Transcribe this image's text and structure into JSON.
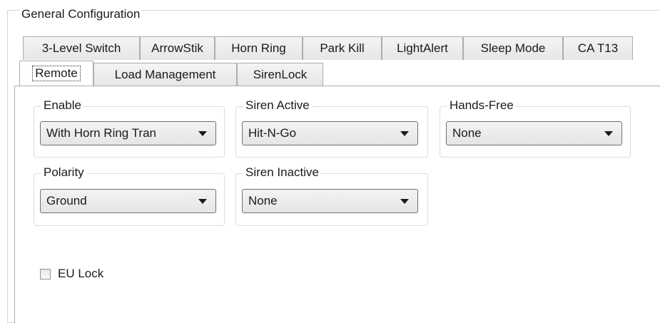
{
  "group_title": "General Configuration",
  "tabs_row1": [
    {
      "label": "3-Level Switch"
    },
    {
      "label": "ArrowStik"
    },
    {
      "label": "Horn Ring"
    },
    {
      "label": "Park Kill"
    },
    {
      "label": "LightAlert"
    },
    {
      "label": "Sleep Mode"
    },
    {
      "label": "CA T13"
    }
  ],
  "tabs_row2": [
    {
      "label": "Remote"
    },
    {
      "label": "Load Management"
    },
    {
      "label": "SirenLock"
    }
  ],
  "selected_tab": "Remote",
  "fields": {
    "enable": {
      "label": "Enable",
      "value": "With Horn Ring Tran"
    },
    "siren_active": {
      "label": "Siren Active",
      "value": "Hit-N-Go"
    },
    "hands_free": {
      "label": "Hands-Free",
      "value": "None"
    },
    "polarity": {
      "label": "Polarity",
      "value": "Ground"
    },
    "siren_inactive": {
      "label": "Siren Inactive",
      "value": "None"
    }
  },
  "eu_lock": {
    "label": "EU Lock",
    "checked": false
  }
}
